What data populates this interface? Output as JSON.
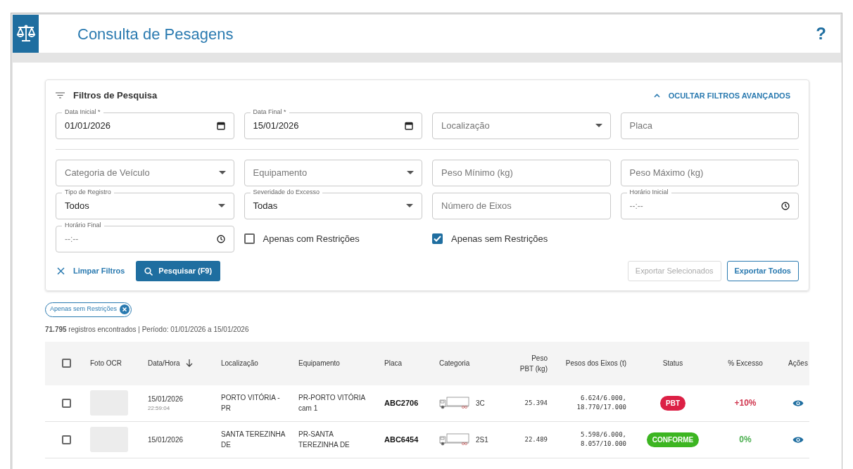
{
  "header": {
    "title": "Consulta de Pesagens",
    "help": "?"
  },
  "filters": {
    "title": "Filtros de Pesquisa",
    "toggle": "OCULTAR FILTROS AVANÇADOS",
    "expanded": true,
    "basic_fields": [
      {
        "kind": "date",
        "label": "Data Inicial *",
        "value": "01/01/2026"
      },
      {
        "kind": "date",
        "label": "Data Final *",
        "value": "15/01/2026"
      },
      {
        "kind": "select",
        "placeholder": "Localização"
      },
      {
        "kind": "text",
        "placeholder": "Placa"
      }
    ],
    "advanced_fields": [
      {
        "kind": "select",
        "placeholder": "Categoria de Veículo"
      },
      {
        "kind": "select",
        "placeholder": "Equipamento"
      },
      {
        "kind": "text",
        "placeholder": "Peso Mínimo (kg)"
      },
      {
        "kind": "text",
        "placeholder": "Peso Máximo (kg)"
      },
      {
        "kind": "select",
        "label": "Tipo de Registro",
        "value": "Todos"
      },
      {
        "kind": "select",
        "label": "Severidade do Excesso",
        "value": "Todas"
      },
      {
        "kind": "text",
        "placeholder": "Número de Eixos"
      },
      {
        "kind": "time",
        "label": "Horário Inicial",
        "placeholder": "--:--"
      },
      {
        "kind": "time",
        "label": "Horário Final",
        "placeholder": "--:--"
      },
      {
        "kind": "checkbox",
        "label": "Apenas com Restrições",
        "checked": false
      },
      {
        "kind": "checkbox",
        "label": "Apenas sem Restrições",
        "checked": true
      }
    ],
    "clear": "Limpar Filtros",
    "search": "Pesquisar (F9)",
    "export_selected": {
      "label": "Exportar Selecionados",
      "disabled": true
    },
    "export_all": {
      "label": "Exportar Todos",
      "disabled": false
    }
  },
  "chips": [
    {
      "label": "Apenas sem Restrições"
    }
  ],
  "summary": "**71.795** registros encontrados | Período: 01/01/2026 a 15/01/2026",
  "table": {
    "columns": [
      {
        "label": "Foto OCR"
      },
      {
        "label": "Data/Hora",
        "sorted": true
      },
      {
        "label": "Localização"
      },
      {
        "label": "Equipamento"
      },
      {
        "label": "Placa"
      },
      {
        "label": "Categoria"
      },
      {
        "label": "Peso PBT (kg)"
      },
      {
        "label": "Pesos dos Eixos (t)"
      },
      {
        "label": "Status"
      },
      {
        "label": "% Excesso"
      },
      {
        "label": "Ações"
      }
    ],
    "header_checked": false,
    "rows": [
      {
        "checked": false,
        "date": "15/01/2026",
        "time": "22:59:04",
        "location": "PORTO VITÓRIA - PR",
        "equipment": "PR-PORTO VITÓRIA cam 1",
        "plate": "ABC2706",
        "category": "3C",
        "weight": "25.394",
        "axles": [
          "6.624/6.000,",
          "18.770/17.000"
        ],
        "status": {
          "label": "PBT",
          "color": "#dc2045"
        },
        "excess": {
          "label": "+10%",
          "color": "#d0364f"
        }
      },
      {
        "checked": false,
        "date": "15/01/2026",
        "location": "SANTA TEREZINHA DE",
        "equipment": "PR-SANTA TEREZINHA DE",
        "plate": "ABC6454",
        "category": "2S1",
        "weight": "22.489",
        "axles": [
          "5.598/6.000,",
          "8.057/10.000"
        ],
        "status": {
          "label": "CONFORME",
          "color": "#3cb521"
        },
        "excess": {
          "label": "0%",
          "color": "#4caf50"
        }
      }
    ]
  }
}
